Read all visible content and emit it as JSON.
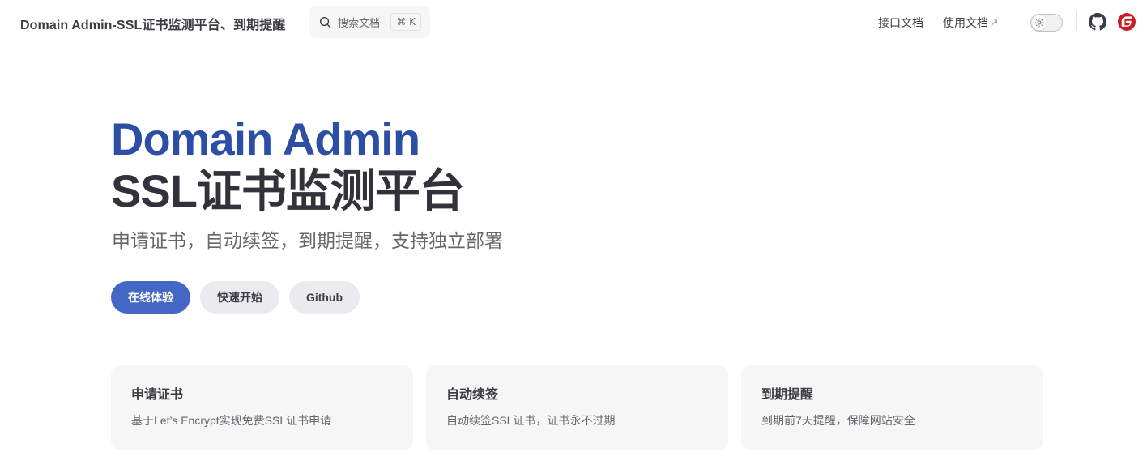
{
  "nav": {
    "site_title": "Domain Admin-SSL证书监测平台、到期提醒",
    "search": {
      "label": "搜索文档",
      "shortcut": "⌘ K",
      "icon": "search-icon"
    },
    "links": [
      {
        "label": "接口文档",
        "external": false
      },
      {
        "label": "使用文档",
        "external": true,
        "external_glyph": "↗"
      }
    ],
    "theme_toggle": {
      "icon": "sun-icon",
      "state": "light"
    },
    "social": [
      {
        "icon": "github-icon"
      },
      {
        "icon": "gitee-icon",
        "color": "#c71d23"
      }
    ]
  },
  "hero": {
    "name": "Domain Admin",
    "text": "SSL证书监测平台",
    "tagline": "申请证书，自动续签，到期提醒，支持独立部署",
    "actions": [
      {
        "label": "在线体验",
        "theme": "brand"
      },
      {
        "label": "快速开始",
        "theme": "alt"
      },
      {
        "label": "Github",
        "theme": "alt"
      }
    ]
  },
  "features": [
    {
      "title": "申请证书",
      "details": "基于Let’s Encrypt实现免费SSL证书申请"
    },
    {
      "title": "自动续签",
      "details": "自动续签SSL证书，证书永不过期"
    },
    {
      "title": "到期提醒",
      "details": "到期前7天提醒，保障网站安全"
    }
  ],
  "colors": {
    "brand": "#2c4ea5",
    "brand_button": "#4466c4",
    "text": "#3c3c43",
    "muted": "#67676c"
  }
}
